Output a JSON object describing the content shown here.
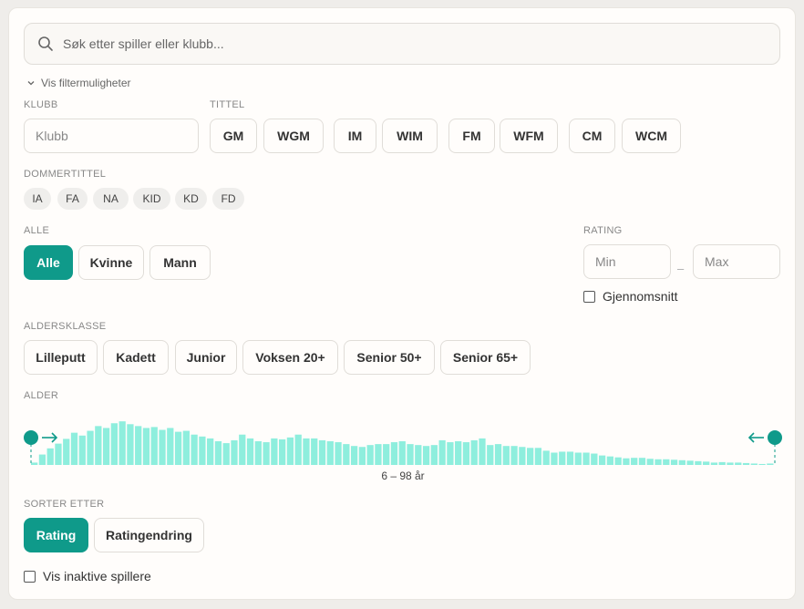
{
  "search": {
    "placeholder": "Søk etter spiller eller klubb..."
  },
  "filter_toggle": "Vis filtermuligheter",
  "klubb": {
    "label": "KLUBB",
    "placeholder": "Klubb"
  },
  "tittel": {
    "label": "TITTEL",
    "options": [
      "GM",
      "WGM",
      "IM",
      "WIM",
      "FM",
      "WFM",
      "CM",
      "WCM"
    ]
  },
  "dommertittel": {
    "label": "DOMMERTITTEL",
    "options": [
      "IA",
      "FA",
      "NA",
      "KID",
      "KD",
      "FD"
    ]
  },
  "kjonn": {
    "label": "ALLE",
    "options": [
      "Alle",
      "Kvinne",
      "Mann"
    ],
    "selected": "Alle"
  },
  "rating": {
    "label": "RATING",
    "min_placeholder": "Min",
    "max_placeholder": "Max",
    "separator": "–",
    "average_label": "Gjennomsnitt"
  },
  "aldersklasse": {
    "label": "ALDERSKLASSE",
    "options": [
      "Lilleputt",
      "Kadett",
      "Junior",
      "Voksen 20+",
      "Senior 50+",
      "Senior 65+"
    ]
  },
  "alder": {
    "label": "ALDER",
    "range_text": "6 – 98 år",
    "min": 6,
    "max": 98,
    "histogram": [
      0.05,
      0.22,
      0.35,
      0.45,
      0.55,
      0.68,
      0.62,
      0.72,
      0.82,
      0.78,
      0.88,
      0.92,
      0.86,
      0.82,
      0.78,
      0.8,
      0.74,
      0.78,
      0.7,
      0.72,
      0.64,
      0.6,
      0.56,
      0.5,
      0.46,
      0.52,
      0.64,
      0.56,
      0.5,
      0.48,
      0.56,
      0.54,
      0.58,
      0.64,
      0.56,
      0.56,
      0.52,
      0.5,
      0.48,
      0.44,
      0.4,
      0.38,
      0.42,
      0.44,
      0.44,
      0.48,
      0.5,
      0.44,
      0.42,
      0.4,
      0.42,
      0.52,
      0.48,
      0.5,
      0.48,
      0.52,
      0.56,
      0.42,
      0.44,
      0.4,
      0.4,
      0.38,
      0.36,
      0.36,
      0.3,
      0.26,
      0.28,
      0.28,
      0.26,
      0.26,
      0.24,
      0.2,
      0.18,
      0.16,
      0.14,
      0.15,
      0.15,
      0.13,
      0.12,
      0.12,
      0.11,
      0.1,
      0.09,
      0.08,
      0.07,
      0.05,
      0.06,
      0.05,
      0.05,
      0.04,
      0.03,
      0.02,
      0.03
    ]
  },
  "sortering": {
    "label": "SORTER ETTER",
    "options": [
      "Rating",
      "Ratingendring"
    ],
    "selected": "Rating"
  },
  "inaktive": {
    "label": "Vis inaktive spillere"
  },
  "colors": {
    "accent": "#0f9a8a",
    "bar": "#8eeedd"
  }
}
